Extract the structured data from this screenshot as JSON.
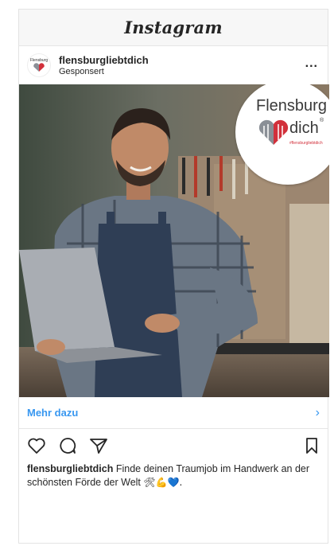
{
  "app": {
    "title": "Instagram"
  },
  "post": {
    "username": "flensburgliebtdich",
    "sponsored_label": "Gesponsert",
    "avatar_text": "Flensburg",
    "more_label": "..."
  },
  "image_badge": {
    "title": "Flensburg",
    "word": "dich",
    "registered": "®",
    "hashtag": "#flensburgliebtdich",
    "colors": {
      "heart_red": "#d2303b",
      "heart_grey": "#8a8f96",
      "text": "#3a3a3a"
    }
  },
  "cta": {
    "label": "Mehr dazu",
    "chevron": "›"
  },
  "actions": {
    "like_icon": "heart-icon",
    "comment_icon": "comment-icon",
    "share_icon": "paper-plane-icon",
    "save_icon": "bookmark-icon"
  },
  "caption": {
    "username": "flensburgliebtdich",
    "text": "Finde deinen Traumjob im Handwerk an der schönsten Förde der Welt",
    "emojis": "🛠💪💙."
  },
  "colors": {
    "link_blue": "#3897f0",
    "text": "#262626",
    "border": "#e6e6e6"
  }
}
